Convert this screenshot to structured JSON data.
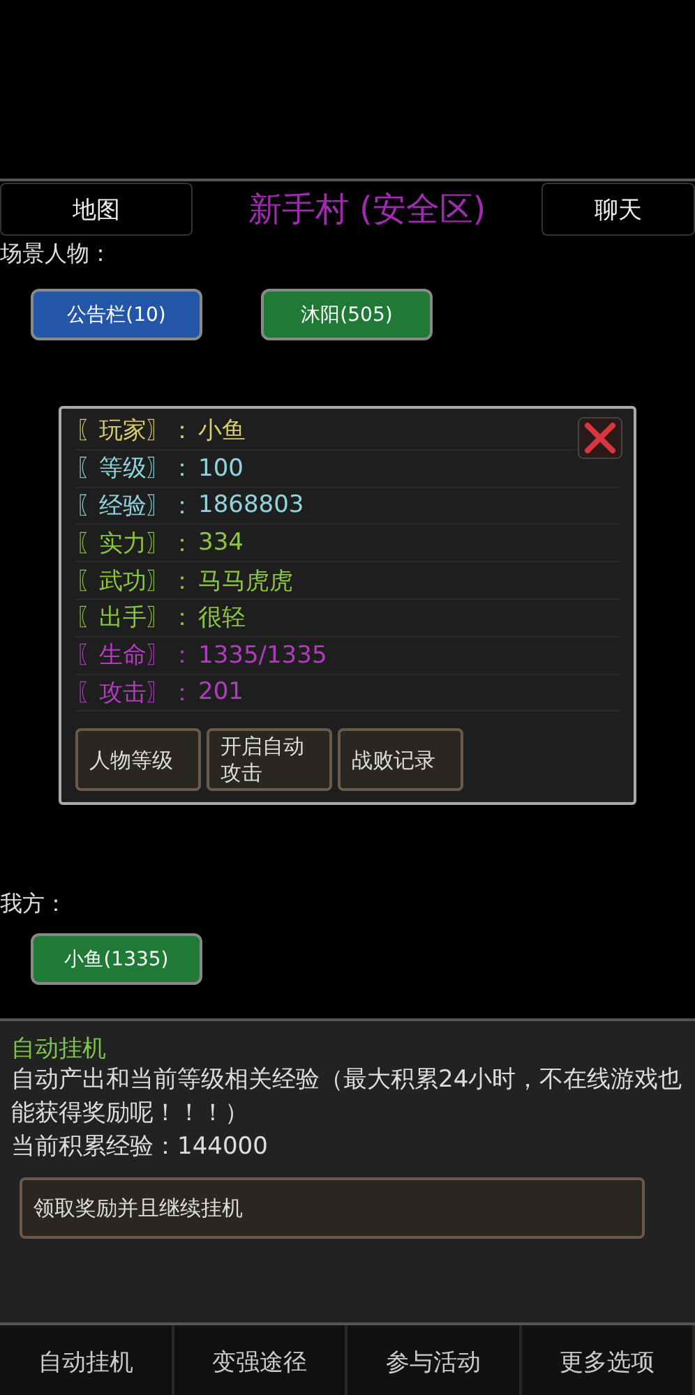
{
  "header": {
    "left_button": "地图",
    "title": "新手村 (安全区)",
    "right_button": "聊天"
  },
  "scene": {
    "label": "场景人物：",
    "units": [
      {
        "name": "公告栏(10)",
        "color": "#2456a8"
      },
      {
        "name": "沐阳(505)",
        "color": "#1f7a35"
      }
    ]
  },
  "dialog": {
    "stats": [
      {
        "label": "〖玩家〗：",
        "value": "小鱼",
        "color": "#d8cf6a"
      },
      {
        "label": "〖等级〗：",
        "value": "100",
        "color": "#8fd3dc"
      },
      {
        "label": "〖经验〗：",
        "value": "1868803",
        "color": "#8fd3dc"
      },
      {
        "label": "〖实力〗：",
        "value": "334",
        "color": "#8cc63f"
      },
      {
        "label": "〖武功〗：",
        "value": "马马虎虎",
        "color": "#8cc63f"
      },
      {
        "label": "〖出手〗：",
        "value": "很轻",
        "color": "#8cc63f"
      },
      {
        "label": "〖生命〗：",
        "value": "1335/1335",
        "color": "#b23cc0"
      },
      {
        "label": "〖攻击〗：",
        "value": "201",
        "color": "#b23cc0"
      }
    ],
    "buttons": [
      "人物等级",
      "开启自动攻击",
      "战败记录"
    ]
  },
  "ours": {
    "label": "我方：",
    "units": [
      {
        "name": "小鱼(1335)",
        "color": "#1f7a35"
      }
    ]
  },
  "idle_panel": {
    "title": "自动挂机",
    "description": "自动产出和当前等级相关经验（最大积累24小时，不在线游戏也能获得奖励呢！！！）",
    "accumulated": "当前积累经验：144000",
    "action": "领取奖励并且继续挂机"
  },
  "bottom_tabs": [
    "自动挂机",
    "变强途径",
    "参与活动",
    "更多选项"
  ]
}
